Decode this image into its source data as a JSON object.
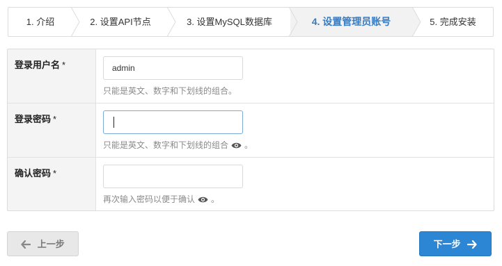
{
  "steps": [
    {
      "label": "1. 介绍",
      "active": false
    },
    {
      "label": "2. 设置API节点",
      "active": false
    },
    {
      "label": "3. 设置MySQL数据库",
      "active": false
    },
    {
      "label": "4. 设置管理员账号",
      "active": true
    },
    {
      "label": "5. 完成安装",
      "active": false
    }
  ],
  "form": {
    "username": {
      "label": "登录用户名",
      "required_mark": "*",
      "value": "admin",
      "help": "只能是英文、数字和下划线的组合。"
    },
    "password": {
      "label": "登录密码",
      "required_mark": "*",
      "value": "",
      "help_before": "只能是英文、数字和下划线的组合",
      "help_after": "。",
      "eye_icon": "eye-icon"
    },
    "confirm": {
      "label": "确认密码",
      "required_mark": "*",
      "value": "",
      "help_before": "再次输入密码以便于确认",
      "help_after": "。",
      "eye_icon": "eye-icon"
    }
  },
  "buttons": {
    "prev_label": "上一步",
    "prev_icon": "arrow-left-icon",
    "next_label": "下一步",
    "next_icon": "arrow-right-icon"
  },
  "colors": {
    "active_step_text": "#3a7bbf",
    "active_step_bg": "#f2f2f2",
    "next_button_bg": "#2d86d3",
    "prev_button_bg": "#e8e8e8"
  }
}
